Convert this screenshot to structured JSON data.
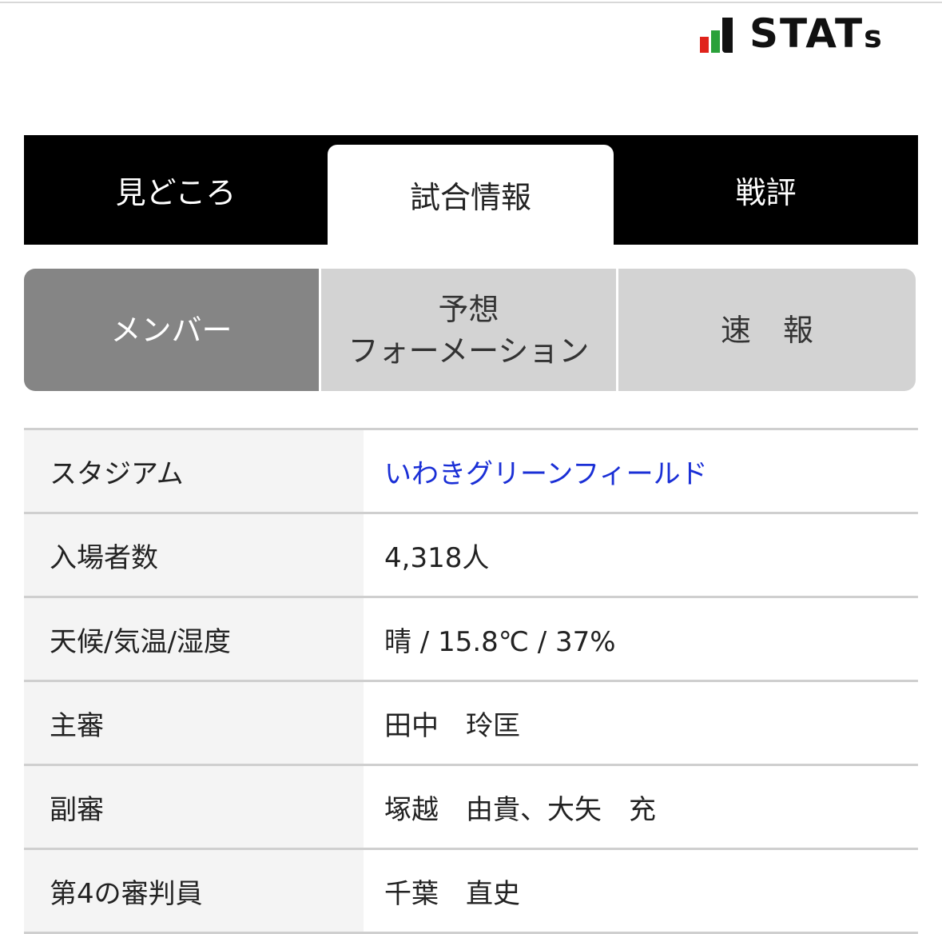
{
  "logo": {
    "text_main": "STAT",
    "text_tail": "s",
    "bar_colors": [
      "#e0231b",
      "#2aa13a",
      "#111111"
    ]
  },
  "main_tabs": [
    {
      "label": "見どころ",
      "active": false
    },
    {
      "label": "試合情報",
      "active": true
    },
    {
      "label": "戦評",
      "active": false
    }
  ],
  "sub_tabs": [
    {
      "label": "メンバー",
      "active": true
    },
    {
      "label_line1": "予想",
      "label_line2": "フォーメーション",
      "active": false
    },
    {
      "label": "速報",
      "active": false
    }
  ],
  "info": [
    {
      "label": "スタジアム",
      "value": "いわきグリーンフィールド",
      "is_link": true
    },
    {
      "label": "入場者数",
      "value": "4,318人"
    },
    {
      "label": "天候/気温/湿度",
      "value": "晴 / 15.8℃ / 37%"
    },
    {
      "label": "主審",
      "value": "田中　玲匡"
    },
    {
      "label": "副審",
      "value": "塚越　由貴、大矢　充"
    },
    {
      "label": "第4の審判員",
      "value": "千葉　直史"
    }
  ],
  "colors": {
    "link": "#1a2fd6",
    "tab_bar": "#000000",
    "subtab_active": "#858585",
    "subtab_inactive": "#d3d3d3"
  }
}
